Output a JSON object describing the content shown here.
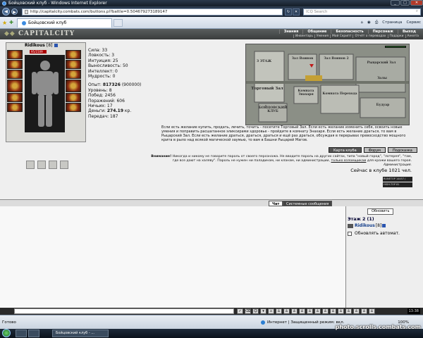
{
  "browser": {
    "window_title": "Бойцовский клуб - Windows Internet Explorer",
    "url": "http://capitalcity.combats.com/buttons.pl?battle=0.504679273189147",
    "search_placeholder": "ICQ Search",
    "tab_title": "Бойцовский клуб",
    "cmd_page": "Страница",
    "cmd_service": "Сервис"
  },
  "game": {
    "logo": "CAPITALCITY",
    "nav": [
      "Знания",
      "Общение",
      "Безопасность",
      "Персонаж",
      "Выход"
    ],
    "subnav": [
      "Инвентарь",
      "Умения",
      "Мой Скрипт",
      "Отчёт о переводах",
      "Подарки",
      "Анкета"
    ],
    "character": {
      "name": "Ridikous",
      "level": "[8]",
      "hp": "95/1509",
      "stats": [
        {
          "label": "Сила:",
          "value": "33"
        },
        {
          "label": "Ловкость:",
          "value": "3"
        },
        {
          "label": "Интуиция:",
          "value": "25"
        },
        {
          "label": "Выносливость:",
          "value": "50"
        },
        {
          "label": "Интеллект:",
          "value": "0"
        },
        {
          "label": "Мудрость:",
          "value": "0"
        }
      ],
      "progress": [
        {
          "label": "Опыт:",
          "value": "817326",
          "extra": "(900000)"
        },
        {
          "label": "Уровень:",
          "value": "8"
        },
        {
          "label": "Побед:",
          "value": "2456"
        },
        {
          "label": "Поражений:",
          "value": "606"
        },
        {
          "label": "Ничьих:",
          "value": "17"
        },
        {
          "label": "Деньги:",
          "value": "274.19",
          "extra": "кр."
        },
        {
          "label": "Передач:",
          "value": "187"
        }
      ]
    },
    "map_labels": [
      "3 ЭТАЖ",
      "Зал Воинов",
      "Зал Воинов 2",
      "Рыцарский Зал",
      "Торговый Зал",
      "Залы",
      "БОЙЦОВСКИЙ КЛУБ",
      "Комната Знахаря",
      "Комната Перехода",
      "Будуар"
    ],
    "description": "Если есть желание купить, продать, лечить, точить - посетите Торговый Зал. Если есть желание изменить себя, освоить новые умения и поправить расшатанное эликсирами здоровье - пройдите в комнату Знахаря. Если есть желание драться, то вам в Рыцарский Зал. Если есть желание драться, драться, драться и ещё раз драться, обсуждая в перерывах превосходство мощного крита в рыло над всякой магической заумью, то вам в Башни Рыцарей Магов.",
    "buttons": {
      "map": "Карта клуба",
      "forum": "Форум",
      "help": "Подсказка"
    },
    "warning_label": "Внимание!",
    "warning_text": "Никогда и никому не говорите пароль от своего персонажа. Не вводите пароль на других сайтах, типа \"новый город\", \"лотерея\", \"там, где все дают на халяву\". Пароль не нужен ни паладинам, ни кланам, ни администрации,",
    "warning_link": "только взломщикам",
    "warning_tail": "для кражи вашего героя.",
    "admin": "Администрация.",
    "online": "Сейчас в клубе 1021 чел.",
    "counters": [
      "RUNETOP 14457 / 1491",
      "HIGH-TOP 81"
    ]
  },
  "chat": {
    "tab_chat": "Чат",
    "tab_system": "Системные сообщения",
    "refresh": "Обновить",
    "floor": "Этаж 2 (1)",
    "user_name": "Ridikous",
    "user_level": "[8]",
    "auto_update": "Обновлять автомат.",
    "clock": "13:38"
  },
  "status": {
    "ready": "Готово",
    "zone": "Интернет | Защищенный режим: вкл.",
    "zoom": "100%"
  },
  "taskbar": {
    "task": "Бойцовский клуб - ..."
  },
  "watermark": "photo.scrolls.combats.com"
}
